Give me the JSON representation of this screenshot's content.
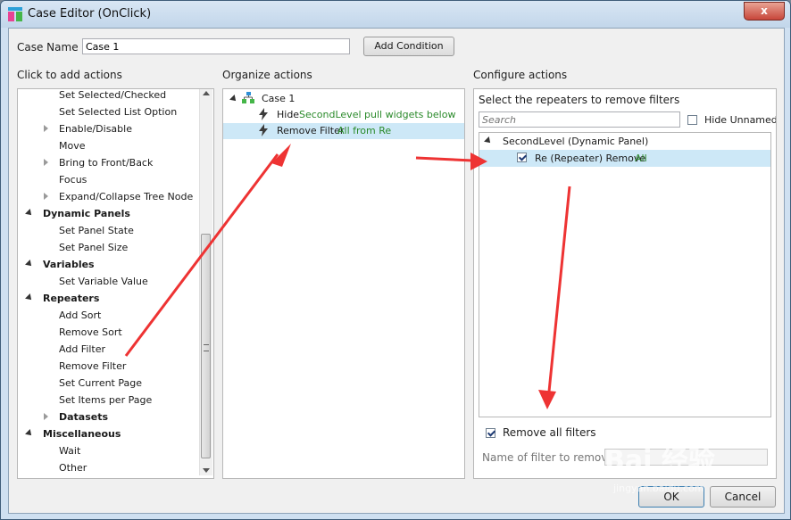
{
  "window": {
    "title": "Case Editor (OnClick)",
    "close_label": "x"
  },
  "case_name": {
    "label": "Case Name",
    "value": "Case 1",
    "add_condition": "Add Condition"
  },
  "left": {
    "header": "Click to add actions",
    "items": [
      {
        "label": "Set Selected/Checked",
        "kind": "sub"
      },
      {
        "label": "Set Selected List Option",
        "kind": "sub"
      },
      {
        "label": "Enable/Disable",
        "kind": "expand"
      },
      {
        "label": "Move",
        "kind": "sub"
      },
      {
        "label": "Bring to Front/Back",
        "kind": "expand"
      },
      {
        "label": "Focus",
        "kind": "sub"
      },
      {
        "label": "Expand/Collapse Tree Node",
        "kind": "expand"
      },
      {
        "label": "Dynamic Panels",
        "kind": "cat"
      },
      {
        "label": "Set Panel State",
        "kind": "sub"
      },
      {
        "label": "Set Panel Size",
        "kind": "sub"
      },
      {
        "label": "Variables",
        "kind": "cat"
      },
      {
        "label": "Set Variable Value",
        "kind": "sub"
      },
      {
        "label": "Repeaters",
        "kind": "cat"
      },
      {
        "label": "Add Sort",
        "kind": "sub"
      },
      {
        "label": "Remove Sort",
        "kind": "sub"
      },
      {
        "label": "Add Filter",
        "kind": "sub"
      },
      {
        "label": "Remove Filter",
        "kind": "sub"
      },
      {
        "label": "Set Current Page",
        "kind": "sub"
      },
      {
        "label": "Set Items per Page",
        "kind": "sub"
      },
      {
        "label": "Datasets",
        "kind": "expand-cat"
      },
      {
        "label": "Miscellaneous",
        "kind": "cat"
      },
      {
        "label": "Wait",
        "kind": "sub"
      },
      {
        "label": "Other",
        "kind": "sub"
      }
    ]
  },
  "middle": {
    "header": "Organize actions",
    "case_label": "Case 1",
    "actions": [
      {
        "verb": "Hide",
        "detail": "SecondLevel pull widgets below"
      },
      {
        "verb": "Remove Filter",
        "detail": "All from Re"
      }
    ]
  },
  "right": {
    "header": "Configure actions",
    "subheader": "Select the repeaters to remove filters",
    "search_placeholder": "Search",
    "hide_unnamed": "Hide Unnamed",
    "tree_parent": "SecondLevel (Dynamic Panel)",
    "tree_child": "Re (Repeater) Remove",
    "tree_child_detail": "All",
    "remove_all_filters": "Remove all filters",
    "filter_name_label": "Name of filter to remove"
  },
  "footer": {
    "ok": "OK",
    "cancel": "Cancel"
  },
  "watermark": {
    "text": "Bai 经验",
    "sub": "jingyan.baidu.com"
  },
  "colors": {
    "accent_green": "#2a8a2a",
    "selection": "#cde8f7",
    "arrow_red": "#ee3333"
  }
}
